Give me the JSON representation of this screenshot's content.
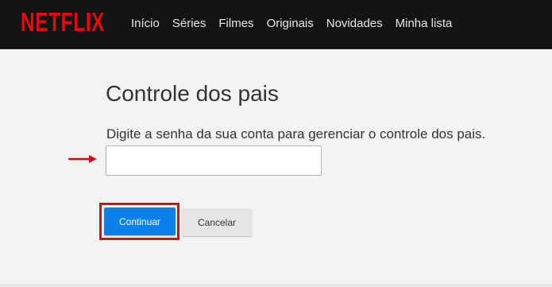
{
  "header": {
    "logo_text": "NETFLIX",
    "nav": [
      "Início",
      "Séries",
      "Filmes",
      "Originais",
      "Novidades",
      "Minha lista"
    ]
  },
  "main": {
    "title": "Controle dos pais",
    "instruction": "Digite a senha da sua conta para gerenciar o controle dos pais.",
    "password": {
      "value": "",
      "placeholder": ""
    },
    "buttons": {
      "continue_label": "Continuar",
      "cancel_label": "Cancelar"
    }
  },
  "annotations": {
    "arrow_icon": "arrow-right-icon",
    "highlight_color": "#d0121c"
  },
  "colors": {
    "brand": "#e50914",
    "primary_button": "#0a80e8",
    "header_bg": "#141414"
  }
}
